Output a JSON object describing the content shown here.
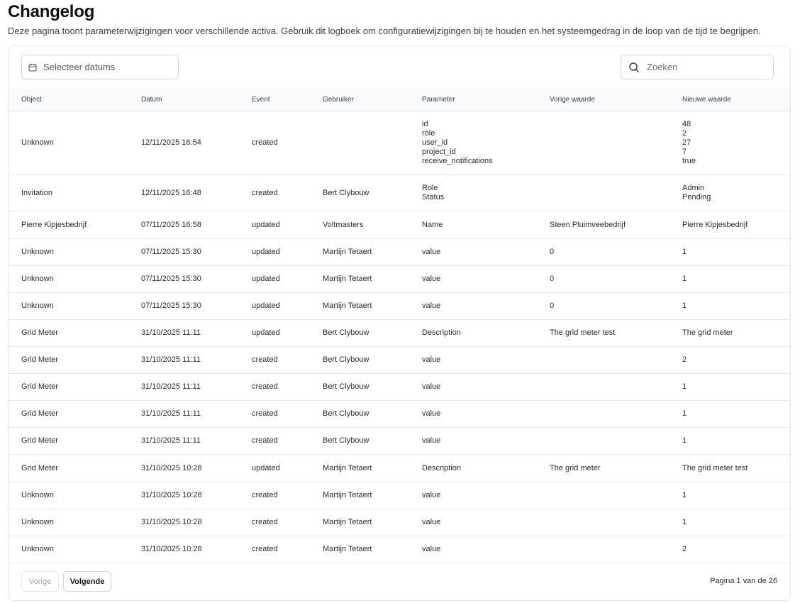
{
  "header": {
    "title": "Changelog",
    "description": "Deze pagina toont parameterwijzigingen voor verschillende activa. Gebruik dit logboek om configuratiewijzigingen bij te houden en het systeemgedrag in de loop van de tijd te begrijpen."
  },
  "filters": {
    "date_placeholder": "Selecteer datums",
    "search_placeholder": "Zoeken",
    "date_icon": "calendar-icon",
    "search_icon": "search-icon"
  },
  "table": {
    "columns": [
      "Object",
      "Datum",
      "Event",
      "Gebruiker",
      "Parameter",
      "Vorige waarde",
      "Nieuwe waarde"
    ],
    "rows": [
      {
        "object": "Unknown",
        "date": "12/11/2025 16:54",
        "event": "created",
        "user": "",
        "params": [
          "id",
          "role",
          "user_id",
          "project_id",
          "receive_notifications"
        ],
        "old": [],
        "new": [
          "48",
          "2",
          "27",
          "7",
          "true"
        ]
      },
      {
        "object": "Invitation",
        "date": "12/11/2025 16:48",
        "event": "created",
        "user": "Bert Clybouw",
        "params": [
          "Role",
          "Status"
        ],
        "old": [],
        "new": [
          "Admin",
          "Pending"
        ]
      },
      {
        "object": "Pierre Kipjesbedrijf",
        "date": "07/11/2025 16:58",
        "event": "updated",
        "user": "Voltmasters",
        "params": [
          "Name"
        ],
        "old": [
          "Steen Pluimveebedrijf"
        ],
        "new": [
          "Pierre Kipjesbedrijf"
        ]
      },
      {
        "object": "Unknown",
        "date": "07/11/2025 15:30",
        "event": "updated",
        "user": "Martijn Tetaert",
        "params": [
          "value"
        ],
        "old": [
          "0"
        ],
        "new": [
          "1"
        ]
      },
      {
        "object": "Unknown",
        "date": "07/11/2025 15:30",
        "event": "updated",
        "user": "Martijn Tetaert",
        "params": [
          "value"
        ],
        "old": [
          "0"
        ],
        "new": [
          "1"
        ]
      },
      {
        "object": "Unknown",
        "date": "07/11/2025 15:30",
        "event": "updated",
        "user": "Martijn Tetaert",
        "params": [
          "value"
        ],
        "old": [
          "0"
        ],
        "new": [
          "1"
        ]
      },
      {
        "object": "Grid Meter",
        "date": "31/10/2025 11:11",
        "event": "updated",
        "user": "Bert Clybouw",
        "params": [
          "Description"
        ],
        "old": [
          "The grid meter test"
        ],
        "new": [
          "The grid meter"
        ]
      },
      {
        "object": "Grid Meter",
        "date": "31/10/2025 11:11",
        "event": "created",
        "user": "Bert Clybouw",
        "params": [
          "value"
        ],
        "old": [],
        "new": [
          "2"
        ]
      },
      {
        "object": "Grid Meter",
        "date": "31/10/2025 11:11",
        "event": "created",
        "user": "Bert Clybouw",
        "params": [
          "value"
        ],
        "old": [],
        "new": [
          "1"
        ]
      },
      {
        "object": "Grid Meter",
        "date": "31/10/2025 11:11",
        "event": "created",
        "user": "Bert Clybouw",
        "params": [
          "value"
        ],
        "old": [],
        "new": [
          "1"
        ]
      },
      {
        "object": "Grid Meter",
        "date": "31/10/2025 11:11",
        "event": "created",
        "user": "Bert Clybouw",
        "params": [
          "value"
        ],
        "old": [],
        "new": [
          "1"
        ]
      },
      {
        "object": "Grid Meter",
        "date": "31/10/2025 10:28",
        "event": "updated",
        "user": "Martijn Tetaert",
        "params": [
          "Description"
        ],
        "old": [
          "The grid meter"
        ],
        "new": [
          "The grid meter test"
        ]
      },
      {
        "object": "Unknown",
        "date": "31/10/2025 10:28",
        "event": "created",
        "user": "Martijn Tetaert",
        "params": [
          "value"
        ],
        "old": [],
        "new": [
          "1"
        ]
      },
      {
        "object": "Unknown",
        "date": "31/10/2025 10:28",
        "event": "created",
        "user": "Martijn Tetaert",
        "params": [
          "value"
        ],
        "old": [],
        "new": [
          "1"
        ]
      },
      {
        "object": "Unknown",
        "date": "31/10/2025 10:28",
        "event": "created",
        "user": "Martijn Tetaert",
        "params": [
          "value"
        ],
        "old": [],
        "new": [
          "2"
        ]
      }
    ]
  },
  "pagination": {
    "prev_label": "Vorige",
    "next_label": "Volgende",
    "status": "Pagina 1 van de 26"
  },
  "colors": {
    "border": "#e5e7eb",
    "header_bg": "#f9fafb",
    "text": "#1f2937",
    "muted": "#9ca3af"
  }
}
